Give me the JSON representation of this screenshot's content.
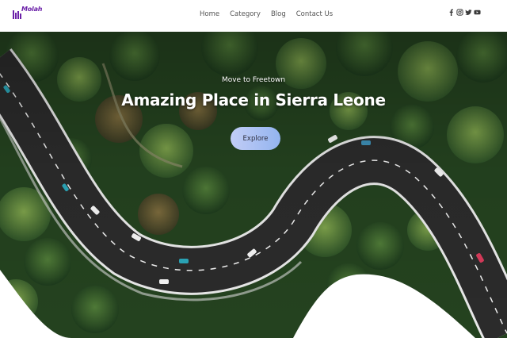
{
  "brand": {
    "logo_text": "Molah"
  },
  "nav": {
    "items": [
      {
        "label": "Home"
      },
      {
        "label": "Category"
      },
      {
        "label": "Blog"
      },
      {
        "label": "Contact Us"
      }
    ]
  },
  "social": {
    "icons": [
      "facebook-icon",
      "instagram-icon",
      "twitter-icon",
      "youtube-icon"
    ]
  },
  "hero": {
    "subtitle": "Move to Freetown",
    "title": "Amazing Place in Sierra Leone",
    "cta_label": "Explore",
    "image": "aerial-forest-road"
  },
  "colors": {
    "brand": "#6b21a8",
    "button_from": "#c2cdf6",
    "button_to": "#93b4ef",
    "nav_text": "#555555",
    "forest": "#1f3a1d",
    "road": "#2b2b2b"
  }
}
